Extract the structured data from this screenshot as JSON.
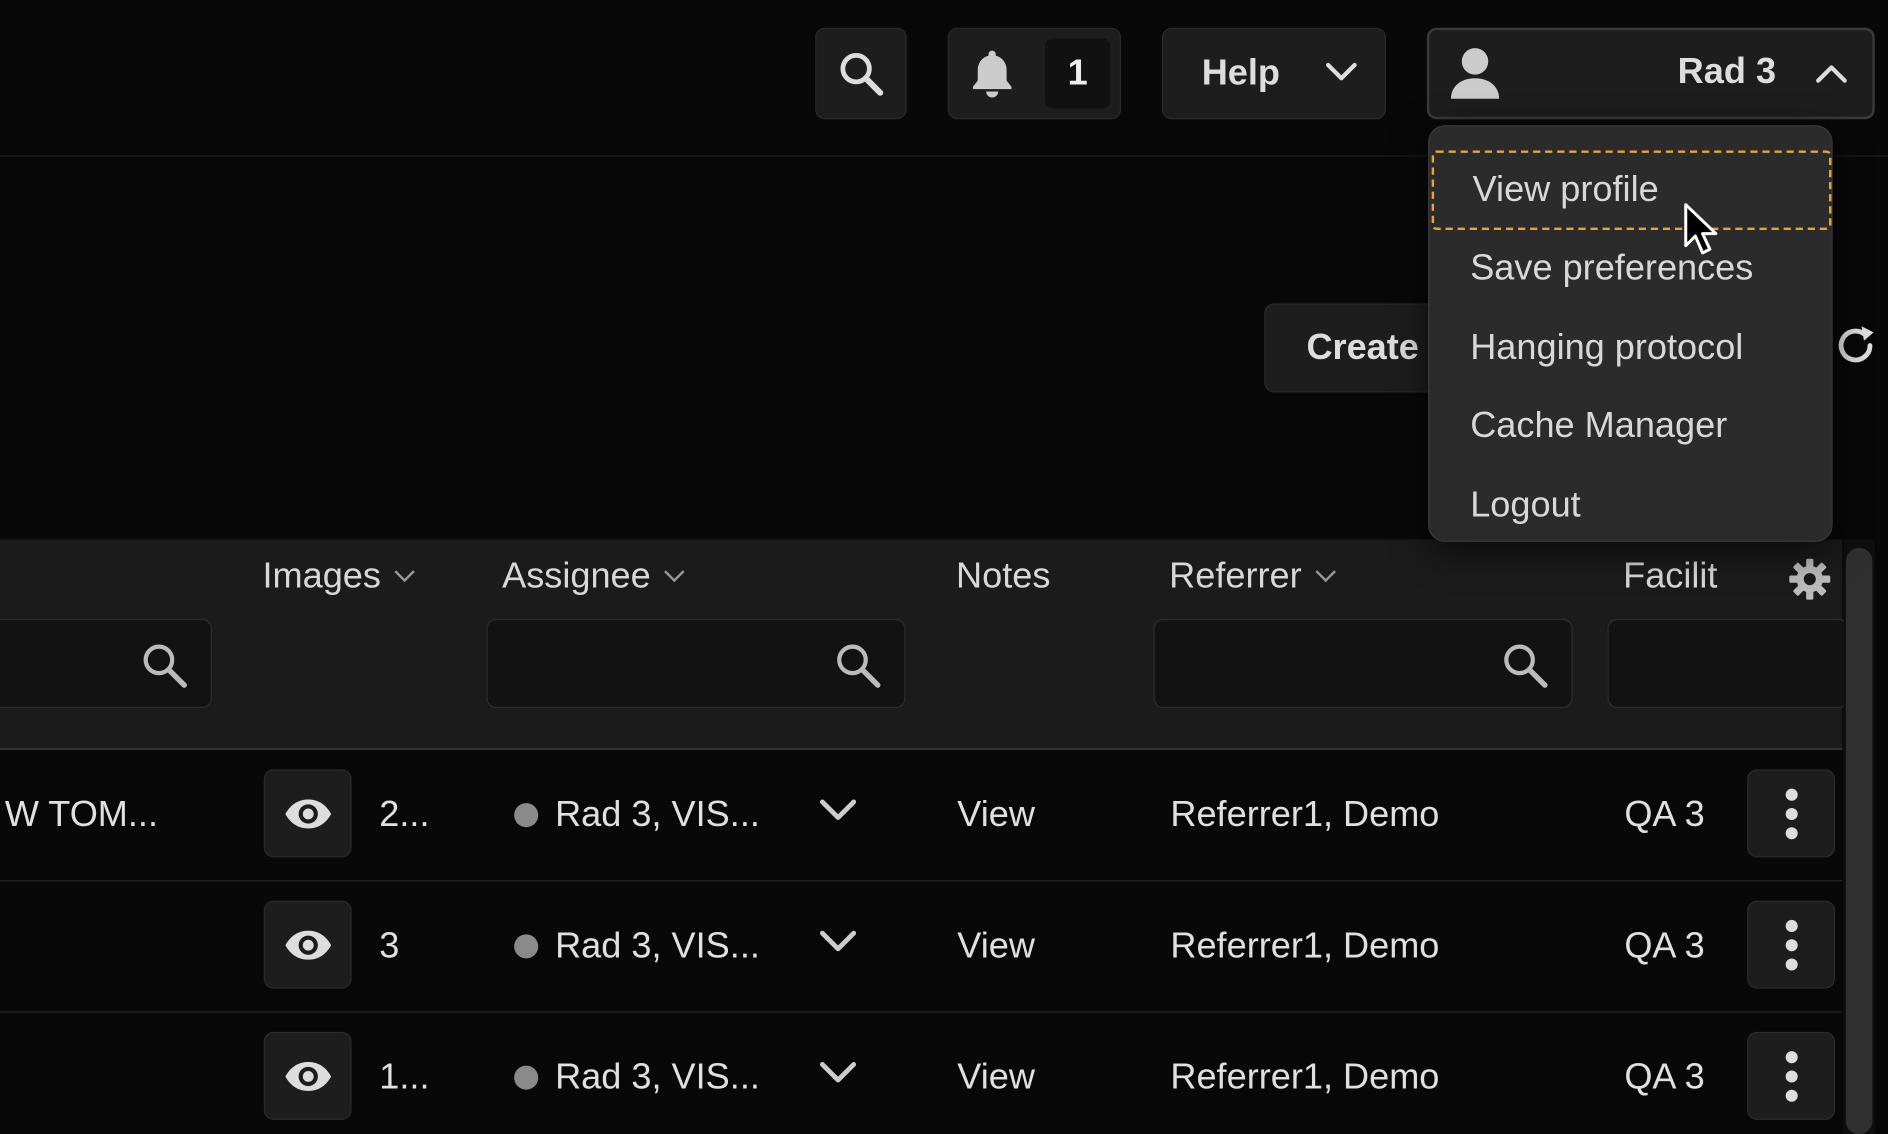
{
  "header": {
    "notification_count": "1",
    "help_label": "Help",
    "user_name": "Rad 3"
  },
  "toolbar": {
    "create_label": "Create"
  },
  "user_menu": {
    "items": [
      "View profile",
      "Save preferences",
      "Hanging protocol",
      "Cache Manager",
      "Logout"
    ],
    "focused_item": "View profile"
  },
  "table": {
    "columns": {
      "images": "Images",
      "assignee": "Assignee",
      "notes": "Notes",
      "referrer": "Referrer",
      "facility": "Facilit"
    },
    "rows": [
      {
        "study": "W TOM...",
        "images": "2...",
        "assignee": "Rad 3, VIS...",
        "notes": "View",
        "referrer": "Referrer1, Demo",
        "facility": "QA 3"
      },
      {
        "study": "",
        "images": "3",
        "assignee": "Rad 3, VIS...",
        "notes": "View",
        "referrer": "Referrer1, Demo",
        "facility": "QA 3"
      },
      {
        "study": "",
        "images": "1...",
        "assignee": "Rad 3, VIS...",
        "notes": "View",
        "referrer": "Referrer1, Demo",
        "facility": "QA 3"
      }
    ]
  },
  "colors": {
    "background": "#080808",
    "surface": "#1d1d1d",
    "menu_bg": "#2b2b2b",
    "focus_outline": "#e8a33a",
    "status_dot": "#8a8a8a"
  }
}
